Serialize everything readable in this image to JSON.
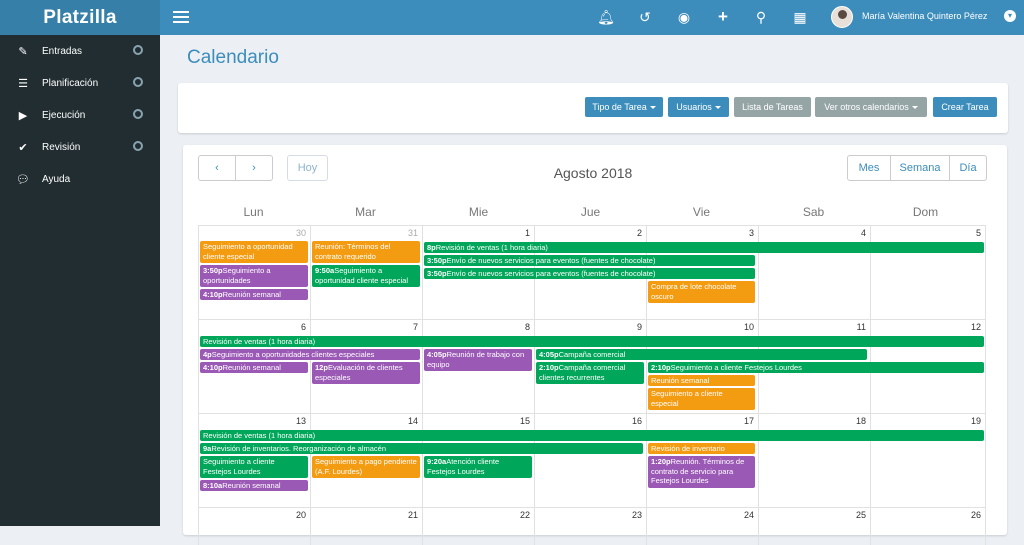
{
  "app": {
    "logo": "Platzilla",
    "user": "María Valentina Quintero Pérez"
  },
  "topbar": {
    "icons": [
      "bell-icon",
      "history-icon",
      "eye-icon",
      "plus-icon",
      "search-icon",
      "grid-icon"
    ]
  },
  "sidebar": {
    "items": [
      {
        "label": "Entradas",
        "icon": "edit-icon"
      },
      {
        "label": "Planificación",
        "icon": "list-icon"
      },
      {
        "label": "Ejecución",
        "icon": "play-icon"
      },
      {
        "label": "Revisión",
        "icon": "check-icon"
      },
      {
        "label": "Ayuda",
        "icon": "chat-icon"
      }
    ]
  },
  "page": {
    "title": "Calendario"
  },
  "toolbar": {
    "tipo": "Tipo de Tarea",
    "usuarios": "Usuarios",
    "lista": "Lista de Tareas",
    "otros": "Ver otros calendarios",
    "crear": "Crear Tarea"
  },
  "calendar": {
    "prev": "‹",
    "next": "›",
    "hoy": "Hoy",
    "title": "Agosto 2018",
    "views": {
      "mes": "Mes",
      "semana": "Semana",
      "dia": "Día"
    },
    "weekdays": [
      "Lun",
      "Mar",
      "Mie",
      "Jue",
      "Vie",
      "Sab",
      "Dom"
    ],
    "days": [
      [
        "30",
        "31",
        "1",
        "2",
        "3",
        "4",
        "5"
      ],
      [
        "6",
        "7",
        "8",
        "9",
        "10",
        "11",
        "12"
      ],
      [
        "13",
        "14",
        "15",
        "16",
        "17",
        "18",
        "19"
      ],
      [
        "20",
        "21",
        "22",
        "23",
        "24",
        "25",
        "26"
      ]
    ],
    "events": {
      "w1": [
        {
          "time": "",
          "text": "Seguimiento a oportunidad cliente especial"
        },
        {
          "time": "3:50p",
          "text": "Seguimiento a oportunidades"
        },
        {
          "time": "4:10p",
          "text": "Reunión semanal"
        },
        {
          "time": "",
          "text": "Reunión: Términos del contrato requerido"
        },
        {
          "time": "9:50a",
          "text": "Seguimiento a oportunidad cliente especial"
        },
        {
          "time": "8p",
          "text": "Revisión de ventas (1 hora diaria)"
        },
        {
          "time": "3:50p",
          "text": "Envío de nuevos servicios para eventos (fuentes de chocolate)"
        },
        {
          "time": "3:50p",
          "text": "Envío de nuevos servicios para eventos (fuentes de chocolate)"
        },
        {
          "time": "",
          "text": "Compra de lote chocolate oscuro"
        }
      ],
      "w2": [
        {
          "time": "",
          "text": "Revisión de ventas (1 hora diaria)"
        },
        {
          "time": "4p",
          "text": "Seguimiento a oportunidades clientes especiales"
        },
        {
          "time": "4:10p",
          "text": "Reunión semanal"
        },
        {
          "time": "12p",
          "text": "Evaluación de clientes especiales"
        },
        {
          "time": "4:05p",
          "text": "Reunión de trabajo con equipo"
        },
        {
          "time": "4:05p",
          "text": "Campaña comercial"
        },
        {
          "time": "2:10p",
          "text": "Campaña comercial clientes recurrentes"
        },
        {
          "time": "2:10p",
          "text": "Seguimiento a cliente Festejos Lourdes"
        },
        {
          "time": "",
          "text": "Reunión semanal"
        },
        {
          "time": "",
          "text": "Seguimiento a cliente especial"
        }
      ],
      "w3": [
        {
          "time": "",
          "text": "Revisión de ventas (1 hora diaria)"
        },
        {
          "time": "9a",
          "text": "Revisión de inventarios. Reorganización de almacén"
        },
        {
          "time": "",
          "text": "Seguimiento a cliente Festejos Lourdes"
        },
        {
          "time": "8:10a",
          "text": "Reunión semanal"
        },
        {
          "time": "",
          "text": "Seguimiento a pago pendiente (A.F. Lourdes)"
        },
        {
          "time": "9:20a",
          "text": "Atención cliente Festejos Lourdes"
        },
        {
          "time": "",
          "text": "Revisión de inventario"
        },
        {
          "time": "1:20p",
          "text": "Reunión. Términos de contrato de servicio para Festejos Lourdes"
        }
      ]
    }
  },
  "colors": {
    "topbar": "#3c8dbc",
    "sidebar": "#222d32",
    "green": "#00a65a",
    "purple": "#9b59b6",
    "yellow": "#f39c12"
  }
}
